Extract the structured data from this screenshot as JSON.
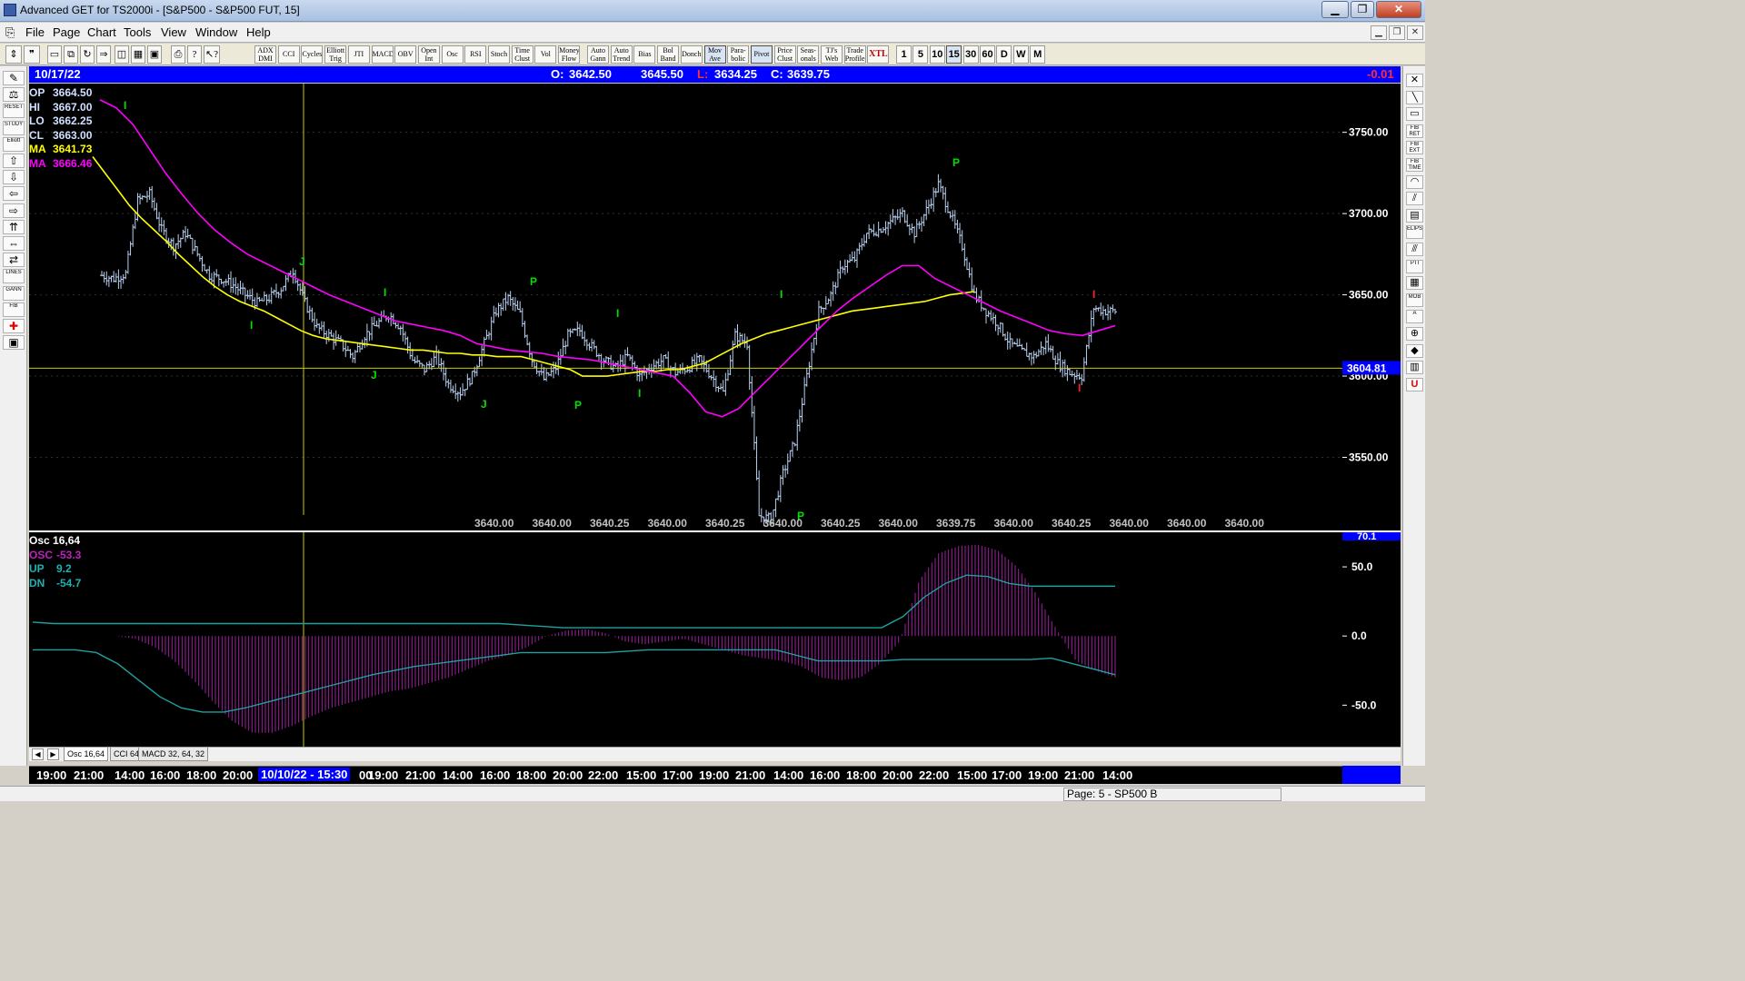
{
  "window": {
    "title": "Advanced GET for TS2000i - [S&P500 - S&P500 FUT, 15]"
  },
  "menu": [
    "File",
    "Page",
    "Chart",
    "Tools",
    "View",
    "Window",
    "Help"
  ],
  "toolbar": {
    "studies": [
      {
        "l1": "ADX",
        "l2": "DMI"
      },
      {
        "l1": "CCI",
        "l2": ""
      },
      {
        "l1": "Cycles",
        "l2": ""
      },
      {
        "l1": "Elliott",
        "l2": "Trig"
      },
      {
        "l1": "JTI",
        "l2": ""
      },
      {
        "l1": "MACD",
        "l2": ""
      },
      {
        "l1": "OBV",
        "l2": ""
      },
      {
        "l1": "Open",
        "l2": "Int"
      },
      {
        "l1": "Osc",
        "l2": ""
      },
      {
        "l1": "RSI",
        "l2": ""
      },
      {
        "l1": "Stoch",
        "l2": ""
      },
      {
        "l1": "Time",
        "l2": "Clust"
      },
      {
        "l1": "Vol",
        "l2": ""
      },
      {
        "l1": "Money",
        "l2": "Flow"
      }
    ],
    "studies2": [
      {
        "l1": "Auto",
        "l2": "Gann"
      },
      {
        "l1": "Auto",
        "l2": "Trend"
      },
      {
        "l1": "Bias",
        "l2": ""
      },
      {
        "l1": "Bol",
        "l2": "Band"
      },
      {
        "l1": "Donch",
        "l2": ""
      },
      {
        "l1": "Mov",
        "l2": "Ave"
      },
      {
        "l1": "Para-",
        "l2": "bolic"
      },
      {
        "l1": "Pivot",
        "l2": ""
      },
      {
        "l1": "Price",
        "l2": "Clust"
      },
      {
        "l1": "Seas-",
        "l2": "onals"
      },
      {
        "l1": "TJ's",
        "l2": "Web"
      },
      {
        "l1": "Trade",
        "l2": "Profile"
      },
      {
        "l1": "XTL",
        "l2": ""
      }
    ],
    "intervals": [
      "1",
      "5",
      "10",
      "15",
      "30",
      "60",
      "D",
      "W",
      "M"
    ],
    "active_interval": "15"
  },
  "left_tools": [
    "",
    "",
    "RESET",
    "STUDY",
    "Elliott",
    "",
    "",
    "",
    "",
    "",
    "",
    "",
    "LINES",
    "GANN",
    "FIB",
    "",
    ""
  ],
  "right_tools": [
    "",
    "",
    "",
    "FIB RET",
    "FIB EXT",
    "FIB TIME",
    "",
    "",
    "",
    "ELIPS",
    "",
    "PTI",
    "",
    "MOB",
    "A",
    "",
    "",
    "",
    "U"
  ],
  "header": {
    "date": "10/17/22",
    "open_label": "O:",
    "open": "3642.50",
    "high": "3645.50",
    "low_label": "L:",
    "low": "3634.25",
    "close_label": "C:",
    "close": "3639.75",
    "change": "-0.01"
  },
  "price_legend": [
    {
      "label": "OP",
      "value": "3664.50",
      "color": "#d0e0ff"
    },
    {
      "label": "HI",
      "value": "3667.00",
      "color": "#d0e0ff"
    },
    {
      "label": "LO",
      "value": "3662.25",
      "color": "#d0e0ff"
    },
    {
      "label": "CL",
      "value": "3663.00",
      "color": "#d0e0ff"
    },
    {
      "label": "MA",
      "value": "3641.73",
      "color": "#ffff00"
    },
    {
      "label": "MA",
      "value": "3666.46",
      "color": "#ff00ff"
    }
  ],
  "osc_legend": [
    {
      "label": "Osc 16,64",
      "value": "",
      "color": "#ffffff"
    },
    {
      "label": "OSC",
      "value": "-53.3",
      "color": "#c020c0"
    },
    {
      "label": "UP",
      "value": "9.2",
      "color": "#20b0b0"
    },
    {
      "label": "DN",
      "value": "-54.7",
      "color": "#20b0b0"
    }
  ],
  "price_axis": {
    "ticks": [
      "3750.00",
      "3700.00",
      "3650.00",
      "3600.00",
      "3550.00"
    ],
    "current": "3604.81",
    "footer": "3639.75"
  },
  "osc_axis": {
    "ticks": [
      "50.0",
      "0.0",
      "-50.0"
    ],
    "top": "70.1"
  },
  "bottom_values": [
    "3640.00",
    "3640.00",
    "3640.25",
    "3640.00",
    "3640.25",
    "3640.00",
    "3640.25",
    "3640.00",
    "3639.75",
    "3640.00",
    "3640.25",
    "3640.00",
    "3640.00",
    "3640.00"
  ],
  "wave_labels": [
    {
      "t": "I",
      "color": "#00e000"
    },
    {
      "t": "I",
      "color": "#00e000"
    },
    {
      "t": "J",
      "color": "#00e000"
    },
    {
      "t": "J",
      "color": "#00e000"
    },
    {
      "t": "I",
      "color": "#00e000"
    },
    {
      "t": "J",
      "color": "#00e000"
    },
    {
      "t": "P",
      "color": "#00e000"
    },
    {
      "t": "P",
      "color": "#00e000"
    },
    {
      "t": "I",
      "color": "#00e000"
    },
    {
      "t": "I",
      "color": "#00e000"
    },
    {
      "t": "I",
      "color": "#00e000"
    },
    {
      "t": "P",
      "color": "#00e000"
    },
    {
      "t": "P",
      "color": "#00e000"
    },
    {
      "t": "I",
      "color": "#ff2020"
    },
    {
      "t": "I",
      "color": "#ff2020"
    }
  ],
  "tabs": [
    "Osc 16,64",
    "CCI 64",
    "MACD 32, 64, 32"
  ],
  "time_axis": [
    "19:00",
    "21:00",
    "14:00",
    "16:00",
    "18:00",
    "20:00",
    "10/10/22 - 15:30",
    "00",
    "19:00",
    "21:00",
    "14:00",
    "16:00",
    "18:00",
    "20:00",
    "22:00",
    "15:00",
    "17:00",
    "19:00",
    "21:00",
    "14:00",
    "16:00",
    "18:00",
    "20:00",
    "22:00",
    "15:00",
    "17:00",
    "19:00",
    "21:00",
    "14:00"
  ],
  "status": {
    "page": "Page: 5 - SP500 B"
  },
  "colors": {
    "ma_fast": "#ffff00",
    "ma_slow": "#ff00ff",
    "bars": "#b8d0f0",
    "osc": "#a020a0",
    "bands": "#20a0a0",
    "header": "#0000ff"
  },
  "chart_data": {
    "type": "line",
    "title": "",
    "ylim": [
      3505,
      3780
    ],
    "series": [
      {
        "name": "price",
        "values": [
          3662,
          3660,
          3663,
          3708,
          3712,
          3690,
          3680,
          3688,
          3675,
          3662,
          3660,
          3656,
          3650,
          3645,
          3648,
          3654,
          3665,
          3645,
          3630,
          3625,
          3620,
          3612,
          3625,
          3632,
          3638,
          3630,
          3610,
          3604,
          3612,
          3595,
          3590,
          3600,
          3620,
          3640,
          3648,
          3638,
          3610,
          3598,
          3605,
          3625,
          3628,
          3618,
          3610,
          3605,
          3612,
          3600,
          3606,
          3610,
          3602,
          3605,
          3610,
          3600,
          3590,
          3625,
          3620,
          3514,
          3512,
          3540,
          3560,
          3600,
          3640,
          3650,
          3668,
          3672,
          3688,
          3690,
          3695,
          3700,
          3688,
          3702,
          3718,
          3700,
          3680,
          3650,
          3640,
          3632,
          3620,
          3615,
          3612,
          3620,
          3608,
          3602,
          3600,
          3642,
          3640
        ]
      },
      {
        "name": "MA",
        "values": [
          3735,
          3725,
          3715,
          3705,
          3697,
          3690,
          3683,
          3675,
          3668,
          3661,
          3655,
          3650,
          3646,
          3643,
          3640,
          3636,
          3632,
          3628,
          3625,
          3623,
          3622,
          3621,
          3620,
          3619,
          3618,
          3617,
          3616,
          3616,
          3615,
          3614,
          3614,
          3613,
          3613,
          3612,
          3612,
          3612,
          3610,
          3608,
          3606,
          3604,
          3600,
          3600,
          3600,
          3601,
          3602,
          3603,
          3603,
          3604,
          3604,
          3606,
          3608,
          3612,
          3616,
          3620,
          3623,
          3626,
          3628,
          3630,
          3632,
          3634,
          3636,
          3638,
          3640,
          3641,
          3642,
          3643,
          3644,
          3645,
          3646,
          3648,
          3650,
          3651,
          3652
        ]
      },
      {
        "name": "MA",
        "values": [
          3770,
          3765,
          3755,
          3740,
          3725,
          3712,
          3700,
          3690,
          3682,
          3675,
          3670,
          3665,
          3660,
          3655,
          3650,
          3646,
          3642,
          3638,
          3634,
          3632,
          3630,
          3628,
          3625,
          3620,
          3618,
          3616,
          3615,
          3614,
          3612,
          3611,
          3610,
          3608,
          3606,
          3604,
          3602,
          3600,
          3590,
          3578,
          3575,
          3580,
          3590,
          3600,
          3610,
          3620,
          3630,
          3640,
          3648,
          3655,
          3662,
          3668,
          3668,
          3660,
          3655,
          3650,
          3645,
          3640,
          3636,
          3632,
          3628,
          3626,
          3625,
          3628,
          3631
        ]
      }
    ],
    "osc": {
      "name": "OSC",
      "values": [
        0,
        -2,
        -8,
        -18,
        -32,
        -48,
        -62,
        -70,
        -70,
        -65,
        -58,
        -52,
        -48,
        -44,
        -40,
        -38,
        -34,
        -30,
        -24,
        -18,
        -14,
        -8,
        0,
        4,
        5,
        2,
        -4,
        -6,
        -4,
        -2,
        -6,
        -10,
        -14,
        -16,
        -18,
        -22,
        -30,
        -32,
        -30,
        -20,
        -4,
        40,
        60,
        65,
        66,
        62,
        50,
        30,
        5,
        -18,
        -25,
        -30
      ],
      "ylim": [
        -80,
        75
      ]
    },
    "up_band": [
      10,
      9,
      9,
      9,
      9,
      9,
      9,
      9,
      9,
      9,
      9,
      9,
      9,
      9,
      9,
      9,
      9,
      9,
      9,
      9,
      9,
      9,
      9,
      8,
      7,
      6,
      6,
      6,
      6,
      6,
      6,
      6,
      6,
      6,
      6,
      6,
      6,
      6,
      6,
      6,
      6,
      14,
      28,
      38,
      44,
      43,
      38,
      36,
      36,
      36,
      36,
      36
    ],
    "dn_band": [
      -10,
      -10,
      -10,
      -12,
      -20,
      -32,
      -44,
      -52,
      -55,
      -55,
      -52,
      -48,
      -44,
      -40,
      -36,
      -32,
      -28,
      -25,
      -22,
      -20,
      -18,
      -16,
      -14,
      -12,
      -12,
      -12,
      -12,
      -12,
      -11,
      -10,
      -10,
      -10,
      -10,
      -10,
      -10,
      -10,
      -14,
      -18,
      -18,
      -18,
      -18,
      -17,
      -17,
      -17,
      -17,
      -17,
      -17,
      -17,
      -16,
      -20,
      -24,
      -28
    ]
  }
}
